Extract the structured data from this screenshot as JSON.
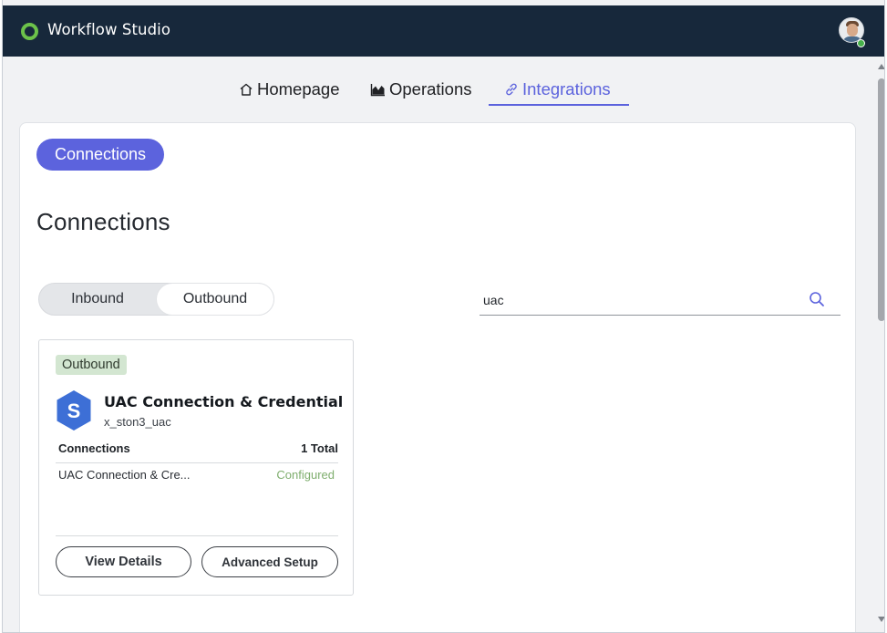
{
  "app": {
    "title": "Workflow Studio",
    "accent_color": "#5c63dd",
    "header_color": "#17283b"
  },
  "nav": {
    "tabs": [
      {
        "label": "Homepage",
        "icon": "home-icon",
        "active": false
      },
      {
        "label": "Operations",
        "icon": "chart-area-icon",
        "active": false
      },
      {
        "label": "Integrations",
        "icon": "link-icon",
        "active": true
      }
    ]
  },
  "main": {
    "pill_label": "Connections",
    "page_title": "Connections",
    "direction_toggle": {
      "options": [
        "Inbound",
        "Outbound"
      ],
      "selected": "Outbound"
    },
    "search": {
      "value": "uac",
      "icon": "search-icon"
    }
  },
  "integration_card": {
    "tag": "Outbound",
    "title": "UAC Connection & Credential",
    "subtitle": "x_ston3_uac",
    "logo_letter": "S",
    "logo_color": "#3d6fd6",
    "table_header": {
      "left": "Connections",
      "right": "1 Total"
    },
    "rows": [
      {
        "name": "UAC Connection & Cre...",
        "status": "Configured",
        "status_color": "#7fae6e"
      }
    ],
    "buttons": {
      "view": "View Details",
      "advanced": "Advanced Setup"
    }
  }
}
